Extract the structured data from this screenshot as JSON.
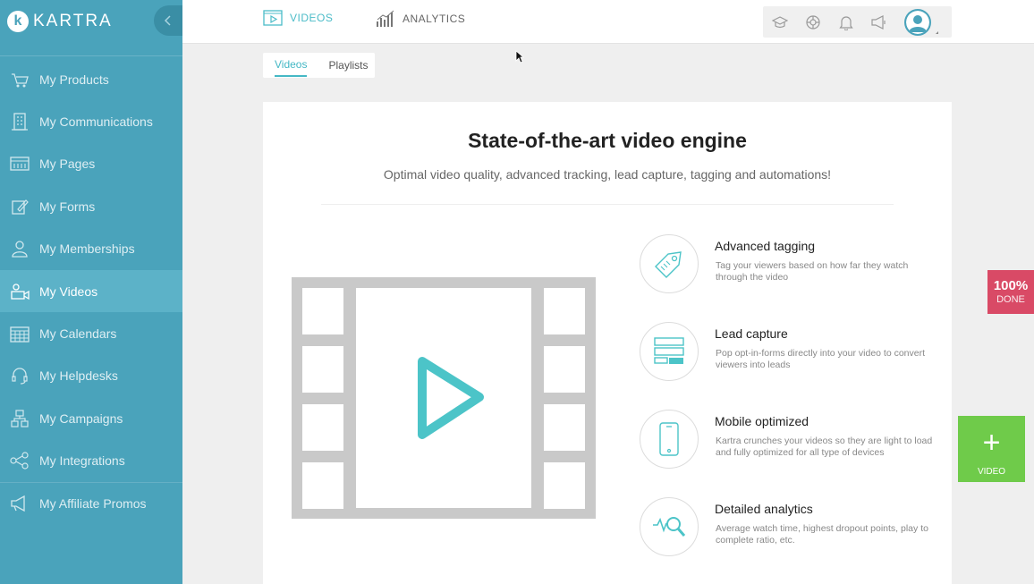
{
  "brand": {
    "logo_letter": "k",
    "name": "KARTRA"
  },
  "sidebar": {
    "items": [
      {
        "label": "My Products",
        "icon": "cart-icon"
      },
      {
        "label": "My Communications",
        "icon": "building-icon"
      },
      {
        "label": "My Pages",
        "icon": "pages-icon"
      },
      {
        "label": "My Forms",
        "icon": "form-pencil-icon"
      },
      {
        "label": "My Memberships",
        "icon": "membership-icon"
      },
      {
        "label": "My Videos",
        "icon": "video-icon",
        "active": true
      },
      {
        "label": "My Calendars",
        "icon": "calendar-icon"
      },
      {
        "label": "My Helpdesks",
        "icon": "headset-icon"
      },
      {
        "label": "My Campaigns",
        "icon": "campaign-icon"
      },
      {
        "label": "My Integrations",
        "icon": "share-icon"
      },
      {
        "label": "My Affiliate Promos",
        "icon": "megaphone-icon"
      }
    ]
  },
  "topnav": {
    "videos_label": "VIDEOS",
    "analytics_label": "ANALYTICS",
    "tools": [
      "graduation-cap-icon",
      "lifebuoy-icon",
      "bell-icon",
      "megaphone-icon"
    ]
  },
  "subtabs": {
    "videos": "Videos",
    "playlists": "Playlists"
  },
  "hero": {
    "title": "State-of-the-art video engine",
    "subtitle": "Optimal video quality, advanced tracking, lead capture, tagging and automations!"
  },
  "features": [
    {
      "title": "Advanced tagging",
      "desc": "Tag your viewers based on how far they watch through the video",
      "icon": "tag-icon"
    },
    {
      "title": "Lead capture",
      "desc": "Pop opt-in-forms directly into your video to convert viewers into leads",
      "icon": "form-icon"
    },
    {
      "title": "Mobile optimized",
      "desc": "Kartra crunches your videos so they are light to load and fully optimized for all type of devices",
      "icon": "mobile-icon"
    },
    {
      "title": "Detailed analytics",
      "desc": "Average watch time, highest dropout points, play to complete ratio, etc.",
      "icon": "analytics-icon"
    }
  ],
  "done_badge": {
    "percent": "100%",
    "label": "DONE"
  },
  "add_video": {
    "plus": "+",
    "label": "VIDEO"
  },
  "colors": {
    "sidebar": "#4aa3bb",
    "accent": "#4cbcc8",
    "done": "#d94a66",
    "add": "#6fcb4a"
  }
}
